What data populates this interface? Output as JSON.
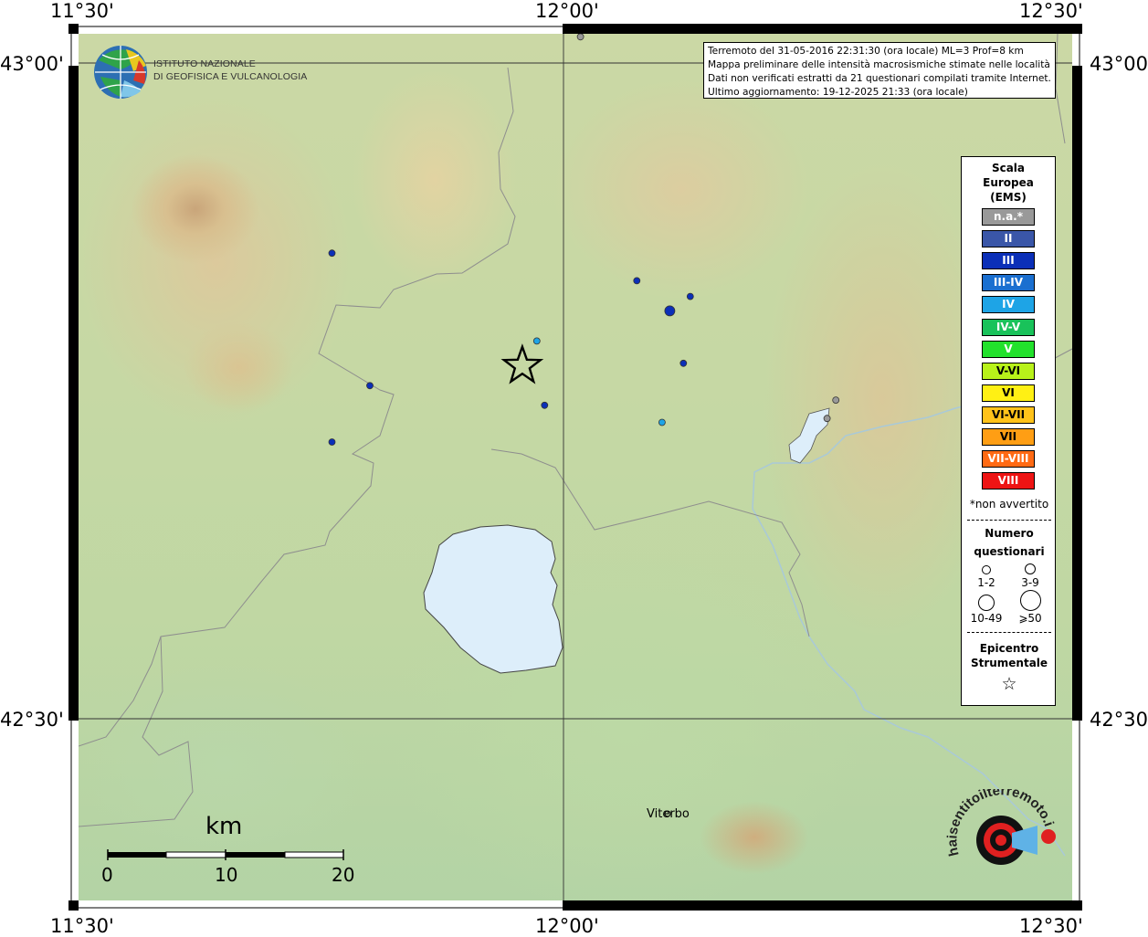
{
  "ticks": {
    "top": [
      "11°30'",
      "12°00'",
      "12°30'"
    ],
    "bottom": [
      "11°30'",
      "12°00'",
      "12°30'"
    ],
    "left": [
      "43°00'",
      "42°30'"
    ],
    "right": [
      "43°00'",
      "42°30'"
    ]
  },
  "logo": {
    "line1": "Istituto Nazionale",
    "line2": "di Geofisica e Vulcanologia"
  },
  "info": {
    "line1": "Terremoto del 31-05-2016 22:31:30 (ora locale) ML=3 Prof=8 km",
    "line2": "Mappa preliminare delle intensità macrosismiche stimate nelle località",
    "line3": "Dati non verificati estratti da 21 questionari compilati tramite Internet.",
    "line4": "Ultimo aggiornamento: 19-12-2025 21:33 (ora locale)"
  },
  "legend": {
    "title": [
      "Scala",
      "Europea",
      "(EMS)"
    ],
    "classes": [
      {
        "label": "n.a.*",
        "color": "#999999"
      },
      {
        "label": "II",
        "color": "#3a56a8"
      },
      {
        "label": "III",
        "color": "#0b2fb8"
      },
      {
        "label": "III-IV",
        "color": "#1a6fd0"
      },
      {
        "label": "IV",
        "color": "#1ea4e6"
      },
      {
        "label": "IV-V",
        "color": "#19c25a"
      },
      {
        "label": "V",
        "color": "#22e12c"
      },
      {
        "label": "V-VI",
        "color": "#b8f21a"
      },
      {
        "label": "VI",
        "color": "#fff014"
      },
      {
        "label": "VI-VII",
        "color": "#ffc21a"
      },
      {
        "label": "VII",
        "color": "#ff9e14"
      },
      {
        "label": "VII-VIII",
        "color": "#ff6a14"
      },
      {
        "label": "VIII",
        "color": "#ee1414"
      }
    ],
    "not_felt": "*non avvertito",
    "count_title": [
      "Numero",
      "questionari"
    ],
    "counts": [
      "1-2",
      "3-9",
      "10-49",
      "⩾50"
    ],
    "epicenter_title": [
      "Epicentro",
      "Strumentale"
    ],
    "epicenter_symbol": "☆"
  },
  "places": {
    "viterbo": "Viterbo"
  },
  "scale": {
    "unit": "km",
    "labels": [
      "0",
      "10",
      "20"
    ]
  },
  "observations": [
    {
      "lon": 11.762,
      "lat": 42.855,
      "intensity": "III"
    },
    {
      "lon": 11.801,
      "lat": 42.754,
      "intensity": "III"
    },
    {
      "lon": 11.762,
      "lat": 42.711,
      "intensity": "III"
    },
    {
      "lon": 11.973,
      "lat": 42.788,
      "intensity": "IV"
    },
    {
      "lon": 11.981,
      "lat": 42.739,
      "intensity": "III"
    },
    {
      "lon": 12.076,
      "lat": 42.834,
      "intensity": "III"
    },
    {
      "lon": 12.131,
      "lat": 42.822,
      "intensity": "III"
    },
    {
      "lon": 12.11,
      "lat": 42.811,
      "intensity": "III",
      "size": "3-9"
    },
    {
      "lon": 12.124,
      "lat": 42.771,
      "intensity": "III"
    },
    {
      "lon": 12.102,
      "lat": 42.726,
      "intensity": "IV"
    },
    {
      "lon": 12.281,
      "lat": 42.743,
      "intensity": "n.a.*"
    },
    {
      "lon": 12.272,
      "lat": 42.729,
      "intensity": "n.a.*"
    },
    {
      "lon": 12.018,
      "lat": 43.02,
      "intensity": "n.a.*"
    }
  ],
  "epicenter": {
    "lon": 11.958,
    "lat": 42.769
  },
  "hai_logo_text": "haisentitoilterremoto.it www."
}
